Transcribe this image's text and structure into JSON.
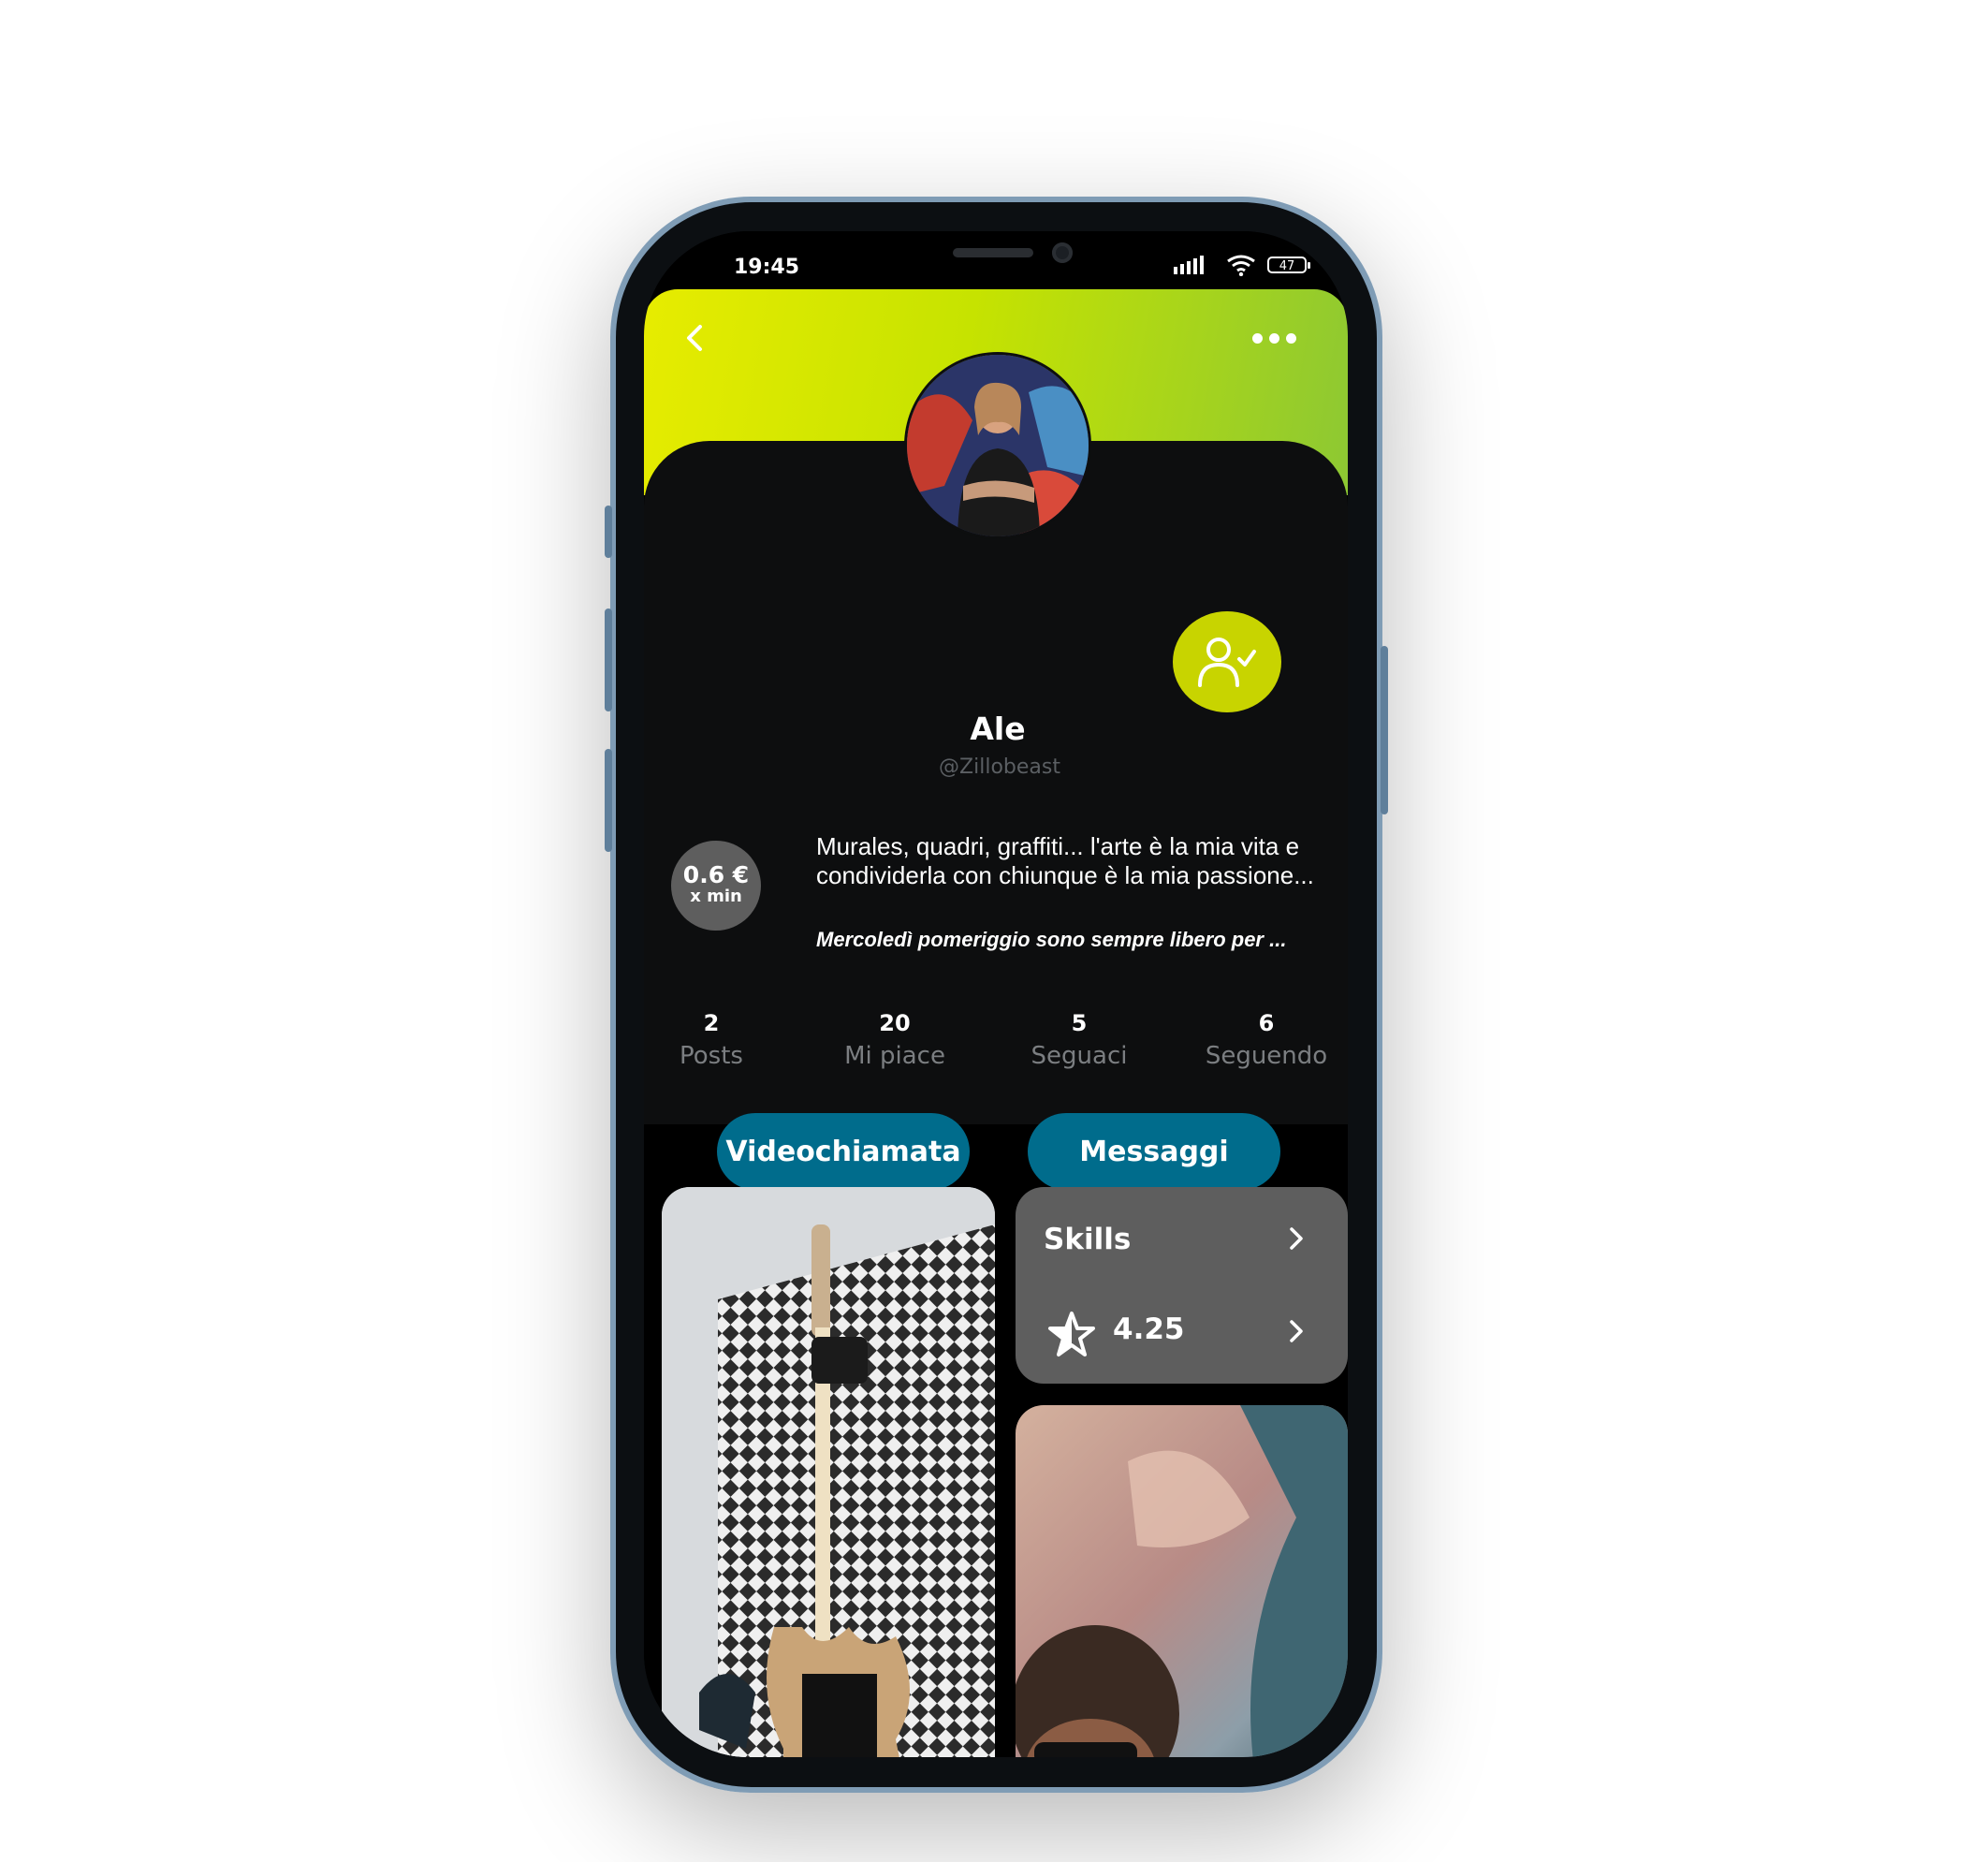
{
  "status_bar": {
    "time": "19:45",
    "battery": "47"
  },
  "profile": {
    "name": "Ale",
    "handle": "@Zillobeast",
    "price": {
      "value": "0.6 €",
      "unit": "x min"
    },
    "bio": "Murales, quadri, graffiti... l'arte è la mia vita e condividerla con chiunque è la mia passione...",
    "availability": "Mercoledì pomeriggio sono sempre libero per ..."
  },
  "stats": [
    {
      "value": "2",
      "label": "Posts"
    },
    {
      "value": "20",
      "label": "Mi piace"
    },
    {
      "value": "5",
      "label": "Seguaci"
    },
    {
      "value": "6",
      "label": "Seguendo"
    }
  ],
  "actions": {
    "video_call": "Videochiamata",
    "messages": "Messaggi"
  },
  "skills": {
    "title": "Skills",
    "rating": "4.25"
  },
  "icons": {
    "back": "chevron-left-icon",
    "more": "more-horizontal-icon",
    "follow": "user-check-icon",
    "star": "star-icon",
    "chevron": "chevron-right-icon"
  },
  "colors": {
    "accent_gradient_start": "#e7ec00",
    "accent_gradient_end": "#8dc833",
    "follow_button": "#c8d400",
    "primary_button": "#006c8c",
    "card_gray": "#5e5e5e",
    "background": "#0d0e0f"
  }
}
